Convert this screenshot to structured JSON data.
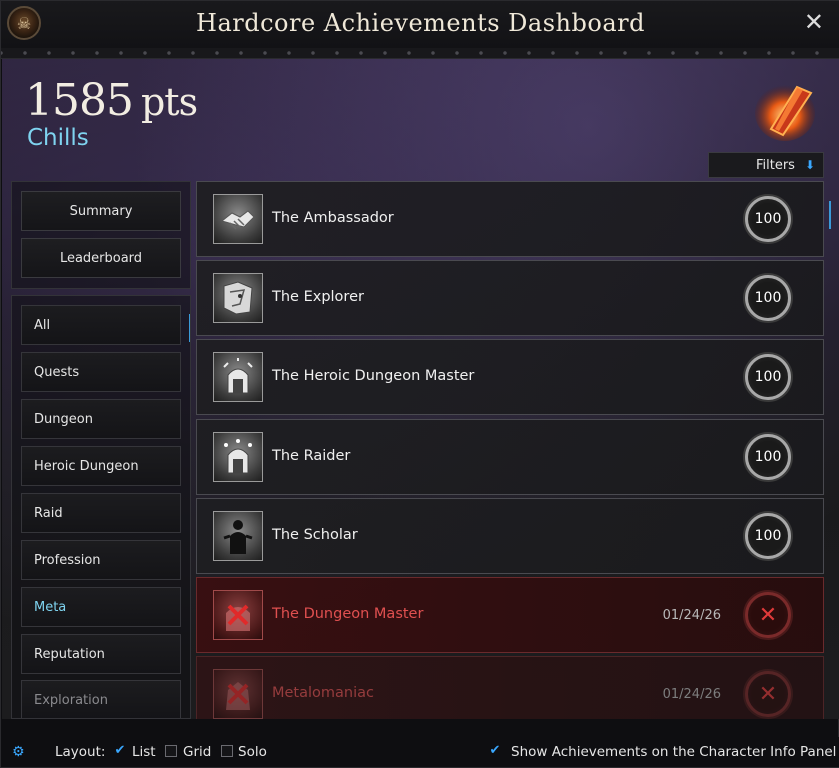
{
  "window": {
    "title": "Hardcore Achievements Dashboard"
  },
  "header": {
    "points": "1585",
    "points_unit": "pts",
    "player": "Chills",
    "filters_label": "Filters"
  },
  "sidebar": {
    "top_buttons": [
      "Summary",
      "Leaderboard"
    ],
    "categories": [
      "All",
      "Quests",
      "Dungeon",
      "Heroic Dungeon",
      "Raid",
      "Profession",
      "Meta",
      "Reputation",
      "Exploration"
    ],
    "active_category": "Meta"
  },
  "achievements": [
    {
      "name": "The Ambassador",
      "points": "100",
      "status": "complete",
      "date": "",
      "icon": "handshake-icon"
    },
    {
      "name": "The Explorer",
      "points": "100",
      "status": "complete",
      "date": "",
      "icon": "map-icon"
    },
    {
      "name": "The Heroic Dungeon Master",
      "points": "100",
      "status": "complete",
      "date": "",
      "icon": "dungeon-icon"
    },
    {
      "name": "The Raider",
      "points": "100",
      "status": "complete",
      "date": "",
      "icon": "raid-icon"
    },
    {
      "name": "The Scholar",
      "points": "100",
      "status": "complete",
      "date": "",
      "icon": "scholar-icon"
    },
    {
      "name": "The Dungeon Master",
      "points": "",
      "status": "failed",
      "date": "01/24/26",
      "icon": "dungeon-icon"
    },
    {
      "name": "Metalomaniac",
      "points": "",
      "status": "failed",
      "date": "01/24/26",
      "icon": "metal-icon"
    }
  ],
  "footer": {
    "layout_label": "Layout:",
    "options": [
      {
        "label": "List",
        "checked": true
      },
      {
        "label": "Grid",
        "checked": false
      },
      {
        "label": "Solo",
        "checked": false
      }
    ],
    "show_panel_label": "Show Achievements on the Character Info Panel",
    "show_panel_checked": true
  },
  "colors": {
    "accent": "#3aa8ff",
    "player": "#7fd4f0",
    "failed": "#e05050"
  }
}
